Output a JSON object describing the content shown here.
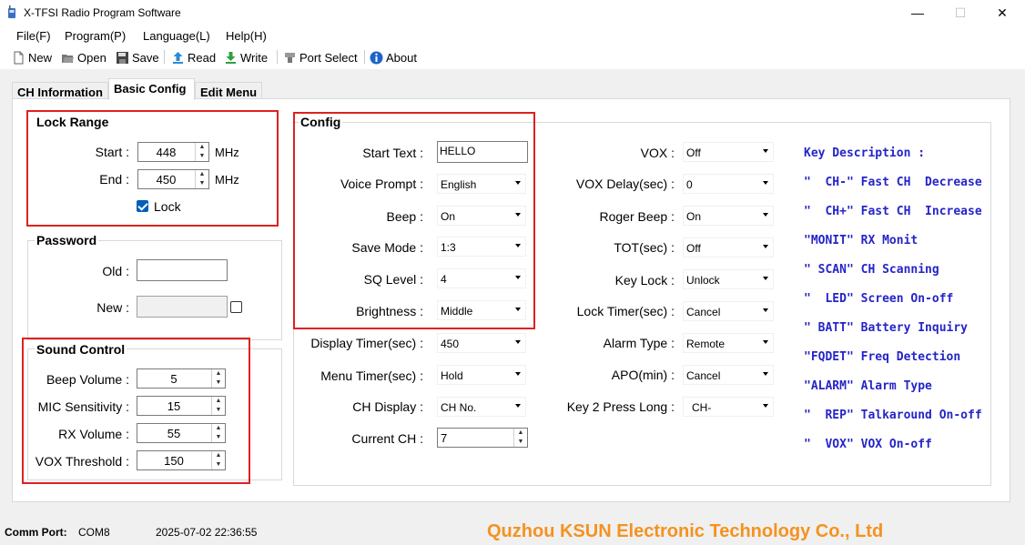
{
  "app": {
    "title": "X-TFSI Radio Program Software"
  },
  "menu": [
    "File(F)",
    "Program(P)",
    "Language(L)",
    "Help(H)"
  ],
  "toolbar": {
    "new": "New",
    "open": "Open",
    "save": "Save",
    "read": "Read",
    "write": "Write",
    "port_select": "Port Select",
    "about": "About"
  },
  "tabs": [
    "CH Information",
    "Basic Config",
    "Edit Menu"
  ],
  "lock_range": {
    "title": "Lock Range",
    "start_label": "Start :",
    "start_value": "448",
    "start_unit": "MHz",
    "end_label": "End :",
    "end_value": "450",
    "end_unit": "MHz",
    "lock_label": "Lock",
    "lock_checked": true
  },
  "password": {
    "title": "Password",
    "old_label": "Old :",
    "old_value": "",
    "new_label": "New :",
    "new_value": ""
  },
  "sound_control": {
    "title": "Sound Control",
    "beep_volume_label": "Beep Volume :",
    "beep_volume": "5",
    "mic_label": "MIC Sensitivity :",
    "mic": "15",
    "rx_label": "RX Volume :",
    "rx": "55",
    "vox_threshold_label": "VOX Threshold :",
    "vox_threshold": "150"
  },
  "config": {
    "title": "Config",
    "start_text_label": "Start Text :",
    "start_text": "HELLO",
    "voice_prompt_label": "Voice Prompt :",
    "voice_prompt": "English",
    "beep_label": "Beep :",
    "beep": "On",
    "save_mode_label": "Save Mode :",
    "save_mode": "1:3",
    "sq_level_label": "SQ Level :",
    "sq_level": "4",
    "brightness_label": "Brightness :",
    "brightness": "Middle",
    "display_timer_label": "Display Timer(sec) :",
    "display_timer": "450",
    "menu_timer_label": "Menu Timer(sec) :",
    "menu_timer": "Hold",
    "ch_display_label": "CH Display :",
    "ch_display": "CH No.",
    "current_ch_label": "Current CH :",
    "current_ch": "7",
    "vox_label": "VOX :",
    "vox": "Off",
    "vox_delay_label": "VOX Delay(sec) :",
    "vox_delay": "0",
    "roger_beep_label": "Roger Beep :",
    "roger_beep": "On",
    "tot_label": "TOT(sec) :",
    "tot": "Off",
    "key_lock_label": "Key Lock :",
    "key_lock": "Unlock",
    "lock_timer_label": "Lock Timer(sec) :",
    "lock_timer": "Cancel",
    "alarm_type_label": "Alarm Type :",
    "alarm_type": "Remote",
    "apo_label": "APO(min) :",
    "apo": "Cancel",
    "key2_label": "Key 2 Press Long :",
    "key2": "CH-"
  },
  "key_description": {
    "title": "Key Description :",
    "lines": [
      "\"  CH-\" Fast CH  Decrease",
      "\"  CH+\" Fast CH  Increase",
      "\"MONIT\" RX Monit",
      "\" SCAN\" CH Scanning",
      "\"  LED\" Screen On-off",
      "\" BATT\" Battery Inquiry",
      "\"FQDET\" Freq Detection",
      "\"ALARM\" Alarm Type",
      "\"  REP\" Talkaround On-off",
      "\"  VOX\" VOX On-off"
    ]
  },
  "status": {
    "comm_port_label": "Comm Port:",
    "comm_port": "COM8",
    "datetime": "2025-07-02 22:36:55",
    "company": "Quzhou KSUN Electronic Technology Co., Ltd"
  },
  "colors": {
    "highlight": "#e02020",
    "key_text": "#2525c8",
    "company": "#f59220"
  }
}
